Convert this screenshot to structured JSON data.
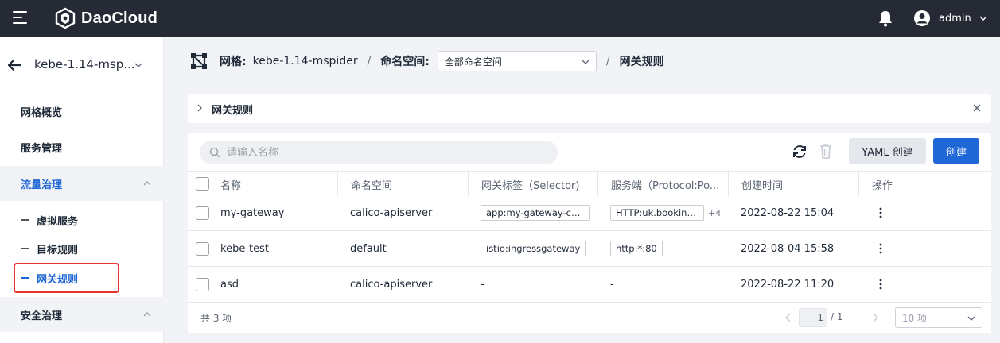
{
  "topbar": {
    "logo_text": "DaoCloud",
    "user_name": "admin"
  },
  "sidebar": {
    "mesh_name": "kebe-1.14-msp...",
    "items": {
      "overview": "网格概览",
      "services": "服务管理",
      "traffic": "流量治理",
      "virtual_service": "虚拟服务",
      "destination_rule": "目标规则",
      "gateway_rule": "网关规则",
      "security": "安全治理"
    }
  },
  "breadcrumb": {
    "mesh_label": "网格:",
    "mesh_value": "kebe-1.14-mspider",
    "sep": "/",
    "ns_label": "命名空间:",
    "ns_value": "全部命名空间",
    "current": "网关规则"
  },
  "collapse": {
    "title": "网关规则"
  },
  "toolbar": {
    "search_placeholder": "请输入名称",
    "yaml_label": "YAML 创建",
    "create_label": "创建"
  },
  "table": {
    "headers": {
      "name": "名称",
      "namespace": "命名空间",
      "selector": "网关标签（Selector)",
      "servers": "服务端（Protocol:Po...",
      "created": "创建时间",
      "actions": "操作"
    },
    "rows": [
      {
        "name": "my-gateway",
        "namespace": "calico-apiserver",
        "selector": "app:my-gateway-con...",
        "servers": "HTTP:uk.bookinfo...",
        "servers_more": "+4",
        "created": "2022-08-22 15:04"
      },
      {
        "name": "kebe-test",
        "namespace": "default",
        "selector": "istio:ingressgateway",
        "servers": "http:*:80",
        "servers_more": "",
        "created": "2022-08-04 15:58"
      },
      {
        "name": "asd",
        "namespace": "calico-apiserver",
        "selector": "-",
        "servers": "-",
        "servers_more": "",
        "created": "2022-08-22 11:20"
      }
    ]
  },
  "footer": {
    "total": "共 3 项",
    "page_current": "1",
    "page_total": "/ 1",
    "page_size": "10 项"
  }
}
